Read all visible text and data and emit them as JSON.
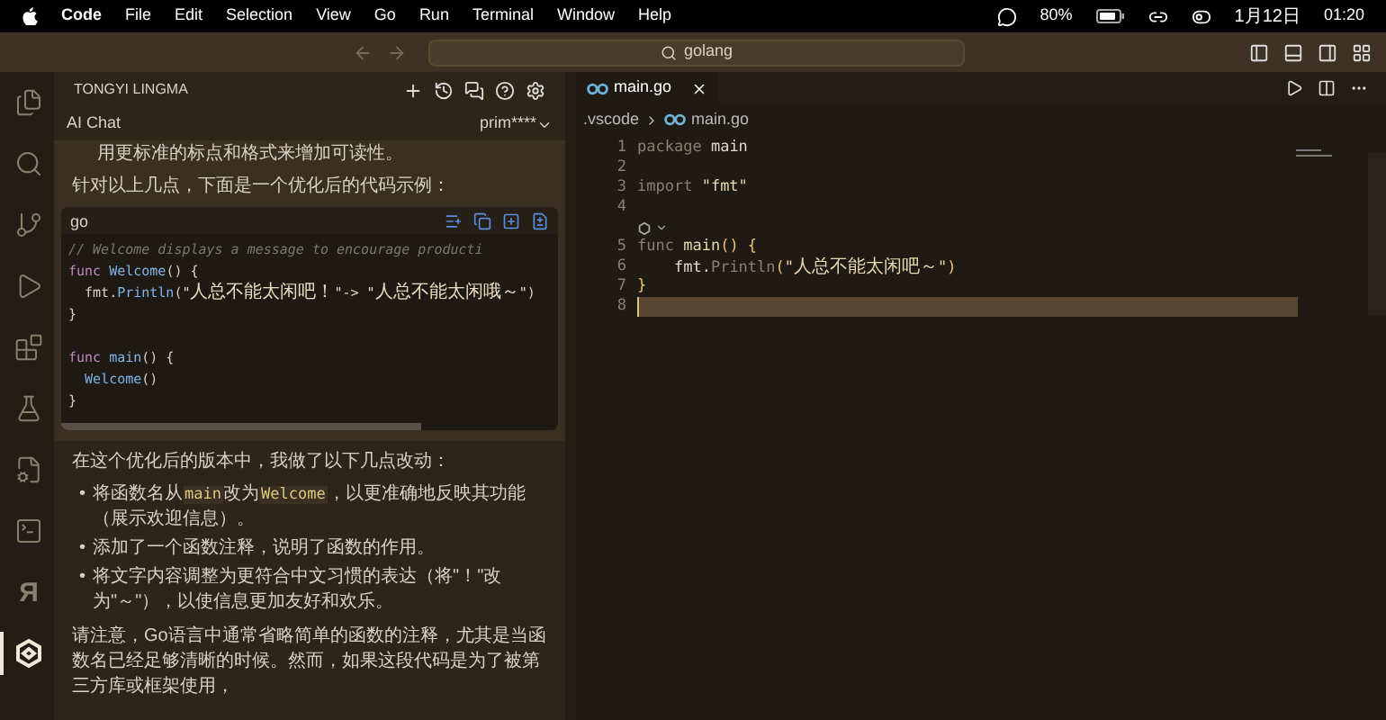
{
  "menubar": {
    "app": "Code",
    "menus": [
      "File",
      "Edit",
      "Selection",
      "View",
      "Go",
      "Run",
      "Terminal",
      "Window",
      "Help"
    ],
    "battery": "80%",
    "date": "1月12日",
    "time": "01:20"
  },
  "titlebar": {
    "search": "golang"
  },
  "activity_bar": [
    {
      "kind": "files",
      "selected": false
    },
    {
      "kind": "search",
      "selected": false
    },
    {
      "kind": "source-control",
      "selected": false
    },
    {
      "kind": "run",
      "selected": false
    },
    {
      "kind": "extensions",
      "selected": false
    },
    {
      "kind": "testing",
      "selected": false
    },
    {
      "kind": "remote",
      "selected": false
    },
    {
      "kind": "terminal",
      "selected": false
    },
    {
      "kind": "glyph",
      "text": "Я",
      "selected": false
    },
    {
      "kind": "lingma",
      "selected": true
    }
  ],
  "chat_panel": {
    "title": "TONGYI LINGMA",
    "tab": "AI Chat",
    "user": "prim****",
    "intro": [
      "用更标准的标点和格式来增加可读性。",
      "针对以上几点，下面是一个优化后的代码示例："
    ],
    "code_block": {
      "language": "go",
      "lines": [
        {
          "kind": "code",
          "tokens": [
            {
              "kind": "comment",
              "text": "// Welcome displays a message to encourage producti"
            }
          ]
        },
        {
          "kind": "code",
          "tokens": [
            {
              "kind": "kw",
              "text": "func "
            },
            {
              "kind": "fn",
              "text": "Welcome"
            },
            {
              "kind": "plain",
              "text": "() {"
            }
          ]
        },
        {
          "kind": "code",
          "tokens": [
            {
              "kind": "plain",
              "text": "  fmt."
            },
            {
              "kind": "fn",
              "text": "Println"
            },
            {
              "kind": "plain",
              "text": "("
            },
            {
              "kind": "str",
              "text": "\"人总不能太闲吧！\"-> \"人总不能太闲哦～\""
            },
            {
              "kind": "plain",
              "text": ")"
            }
          ]
        },
        {
          "kind": "code",
          "tokens": [
            {
              "kind": "plain",
              "text": "}"
            }
          ]
        },
        {
          "kind": "blank"
        },
        {
          "kind": "code",
          "tokens": [
            {
              "kind": "kw",
              "text": "func "
            },
            {
              "kind": "fn",
              "text": "main"
            },
            {
              "kind": "plain",
              "text": "() {"
            }
          ]
        },
        {
          "kind": "code",
          "tokens": [
            {
              "kind": "fn",
              "text": "  Welcome"
            },
            {
              "kind": "plain",
              "text": "()"
            }
          ]
        },
        {
          "kind": "code",
          "tokens": [
            {
              "kind": "plain",
              "text": "}"
            }
          ]
        }
      ]
    },
    "summary": "在这个优化后的版本中，我做了以下几点改动：",
    "bullets": [
      {
        "marker": "•",
        "parts": [
          {
            "kind": "text",
            "text": "将函数名从"
          },
          {
            "kind": "code",
            "text": "main"
          },
          {
            "kind": "text",
            "text": "改为"
          },
          {
            "kind": "code",
            "text": "Welcome"
          },
          {
            "kind": "text",
            "text": "，以更准确地反映其功能（展示欢迎信息）。"
          }
        ]
      },
      {
        "marker": "•",
        "parts": [
          {
            "kind": "text",
            "text": "添加了一个函数注释，说明了函数的作用。"
          }
        ]
      },
      {
        "marker": "•",
        "parts": [
          {
            "kind": "text",
            "text": "将文字内容调整为更符合中文习惯的表达（将\"！\"改为\"～\"），以使信息更加友好和欢乐。"
          }
        ]
      }
    ],
    "note": "请注意，Go语言中通常省略简单的函数的注释，尤其是当函数名已经足够清晰的时候。然而，如果这段代码是为了被第三方库或框架使用，"
  },
  "editor": {
    "tab": "main.go",
    "breadcrumb": [
      ".vscode",
      "main.go"
    ],
    "lines": [
      {
        "kind": "code",
        "number": "1",
        "tokens": [
          {
            "kind": "dim",
            "text": "package "
          },
          {
            "kind": "plain",
            "text": "main"
          }
        ]
      },
      {
        "kind": "code",
        "number": "2"
      },
      {
        "kind": "code",
        "number": "3",
        "tokens": [
          {
            "kind": "dim",
            "text": "import "
          },
          {
            "kind": "str",
            "text": "\"fmt\""
          }
        ]
      },
      {
        "kind": "code",
        "number": "4"
      },
      {
        "kind": "codelens"
      },
      {
        "kind": "code",
        "number": "5",
        "tokens": [
          {
            "kind": "dim",
            "text": "func "
          },
          {
            "kind": "str",
            "text": "main"
          },
          {
            "kind": "punct",
            "text": "() {"
          }
        ]
      },
      {
        "kind": "code",
        "number": "6",
        "tokens": [
          {
            "kind": "plain",
            "text": "    fmt."
          },
          {
            "kind": "dim",
            "text": "Println"
          },
          {
            "kind": "punct",
            "text": "("
          },
          {
            "kind": "str",
            "text": "\"人总不能太闲吧～\""
          },
          {
            "kind": "punct",
            "text": ")"
          }
        ]
      },
      {
        "kind": "code",
        "number": "7",
        "tokens": [
          {
            "kind": "punct",
            "text": "}"
          }
        ]
      },
      {
        "kind": "code",
        "number": "8",
        "current": true
      }
    ]
  }
}
